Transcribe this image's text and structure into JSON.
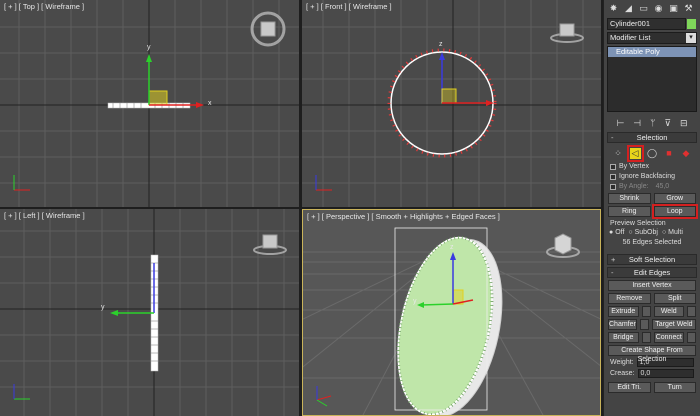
{
  "viewports": {
    "top": {
      "label": "[ + ] [ Top ] [ Wireframe ]"
    },
    "front": {
      "label": "[ + ] [ Front ] [ Wireframe ]"
    },
    "left": {
      "label": "[ + ] [ Left ] [ Wireframe ]"
    },
    "perspective": {
      "label": "[ + ] [ Perspective ] [ Smooth + Highlights + Edged Faces ]"
    }
  },
  "axes": {
    "x": "x",
    "y": "y",
    "z": "z"
  },
  "panel": {
    "tab_icons": [
      "✸",
      "◢",
      "▭",
      "◉",
      "▣",
      "⚒"
    ],
    "object_name": "Cylinder001",
    "object_color": "#7fd65a",
    "modifier_list": "Modifier List",
    "stack_item": "Editable Poly",
    "stack_icons": [
      "⊢",
      "⊣",
      "ᛘ",
      "⊽",
      "⊟"
    ],
    "selection": {
      "title": "Selection",
      "by_vertex": "By Vertex",
      "ignore_backfacing": "Ignore Backfacing",
      "by_angle": "By Angle:",
      "angle_value": "45,0",
      "shrink": "Shrink",
      "grow": "Grow",
      "ring": "Ring",
      "loop": "Loop",
      "preview_title": "Preview Selection",
      "preview_options": [
        "Off",
        "SubObj",
        "Multi"
      ],
      "status": "56 Edges Selected"
    },
    "soft_selection": "Soft Selection",
    "edit_edges": {
      "title": "Edit Edges",
      "insert_vertex": "Insert Vertex",
      "remove": "Remove",
      "split": "Split",
      "extrude": "Extrude",
      "weld": "Weld",
      "chamfer": "Chamfer",
      "target_weld": "Target Weld",
      "bridge": "Bridge",
      "connect": "Connect",
      "create_shape": "Create Shape From Selection",
      "weight_label": "Weight:",
      "weight_value": "1,0",
      "crease_label": "Crease:",
      "crease_value": "0,0",
      "edit_tri": "Edit Tri.",
      "turn": "Turn"
    }
  }
}
